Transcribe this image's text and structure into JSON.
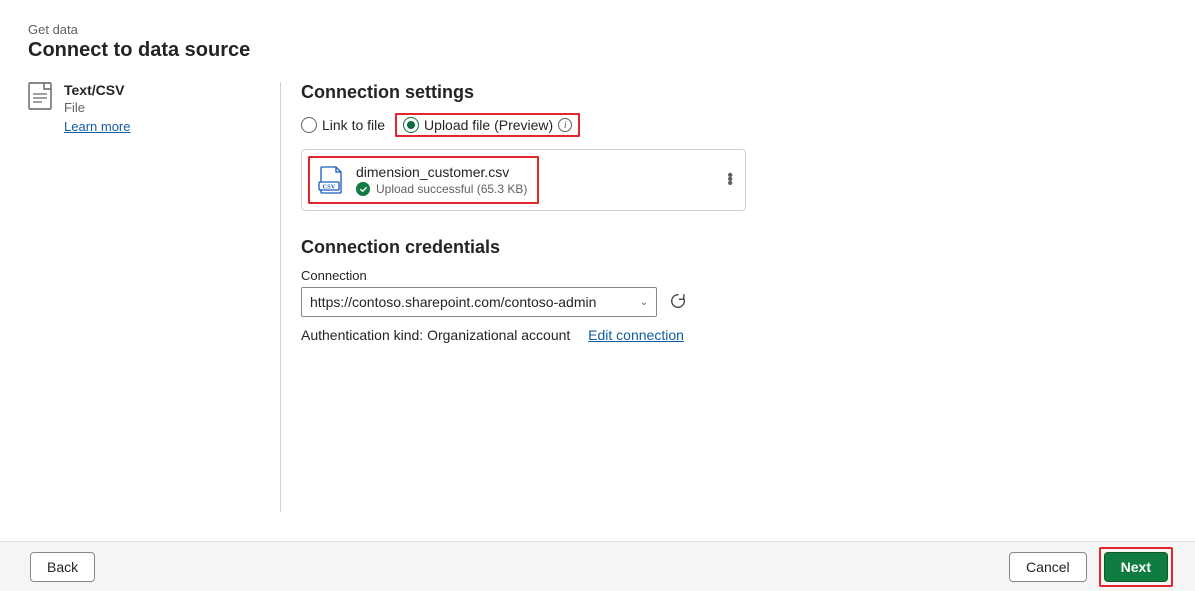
{
  "header": {
    "breadcrumb": "Get data",
    "title": "Connect to data source"
  },
  "sidebar": {
    "source_name": "Text/CSV",
    "source_subtitle": "File",
    "learn_more": "Learn more"
  },
  "settings": {
    "title": "Connection settings",
    "radio_link": "Link to file",
    "radio_upload": "Upload file (Preview)",
    "file": {
      "name": "dimension_customer.csv",
      "status": "Upload successful (65.3 KB)"
    }
  },
  "credentials": {
    "title": "Connection credentials",
    "connection_label": "Connection",
    "connection_value": "https://contoso.sharepoint.com/contoso-admin",
    "auth_text": "Authentication kind: Organizational account",
    "edit_link": "Edit connection"
  },
  "footer": {
    "back": "Back",
    "cancel": "Cancel",
    "next": "Next"
  }
}
